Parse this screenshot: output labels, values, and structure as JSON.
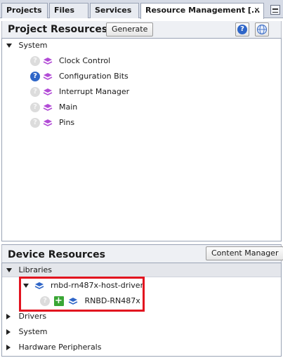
{
  "tabs": [
    {
      "label": "Projects"
    },
    {
      "label": "Files"
    },
    {
      "label": "Services"
    },
    {
      "label": "Resource Management [..."
    }
  ],
  "tab_close_glyph": "×",
  "project_resources": {
    "title": "Project Resources",
    "generate_label": "Generate",
    "help_glyph": "?",
    "tree": {
      "root": "System",
      "children": [
        {
          "label": "Clock Control",
          "status": "grey"
        },
        {
          "label": "Configuration Bits",
          "status": "blue"
        },
        {
          "label": "Interrupt Manager",
          "status": "grey"
        },
        {
          "label": "Main",
          "status": "grey"
        },
        {
          "label": "Pins",
          "status": "grey"
        }
      ]
    }
  },
  "device_resources": {
    "title": "Device Resources",
    "content_manager_label": "Content Manager",
    "libraries_label": "Libraries",
    "library": {
      "name": "rnbd-rn487x-host-driver",
      "child": "RNBD-RN487x",
      "plus_glyph": "+"
    },
    "collapsed": [
      {
        "label": "Drivers"
      },
      {
        "label": "System"
      },
      {
        "label": "Hardware Peripherals"
      }
    ]
  },
  "colors": {
    "purple_layer": "#b24bd6",
    "blue_layer": "#2f66c8",
    "highlight": "#e2131f",
    "help_blue": "#2f66c8"
  }
}
